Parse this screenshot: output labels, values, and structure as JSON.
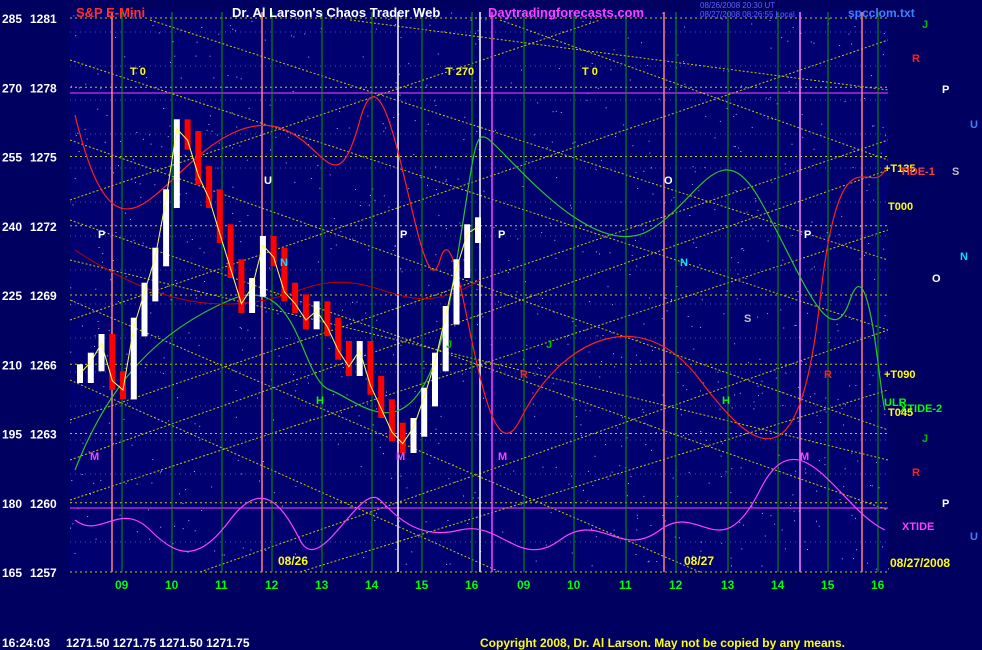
{
  "header": {
    "title_left": "S&P E-Mini",
    "title_center": "Dr. Al Larson's Chaos Trader Web",
    "site": "Daytradingforecasts.com",
    "file": "spcclom.txt",
    "small_info_1": "08/26/2008 20:30 UT",
    "small_info_2": "08/27/2008 08:26:55 Local"
  },
  "footer": {
    "time": "16:24:03",
    "quote": "1271.50  1271.75  1271.50  1271.75",
    "copyright": "Copyright 2008, Dr. Al Larson. May not be copied by any means."
  },
  "colors": {
    "background": "#000060",
    "price_up": "#ffffff",
    "price_down": "#ff0000",
    "grid_green": "#00c000",
    "grid_yellow": "#c8c800",
    "tide": "#ff40ff",
    "accent_text": "#ffff00"
  },
  "chart_data": {
    "type": "line",
    "y_axis_left_numbers": [
      "285",
      "270",
      "255",
      "240",
      "225",
      "210",
      "195",
      "180",
      "165"
    ],
    "y_axis_prices": [
      "1281",
      "1278",
      "1275",
      "1272",
      "1269",
      "1266",
      "1263",
      "1260",
      "1257"
    ],
    "ylim": [
      1257,
      1281
    ],
    "x_tick_labels": [
      "09",
      "10",
      "11",
      "12",
      "13",
      "14",
      "15",
      "16",
      "09",
      "10",
      "11",
      "12",
      "13",
      "14",
      "15",
      "16"
    ],
    "date_labels": [
      "08/26",
      "08/27",
      "08/27/2008"
    ],
    "series": [
      {
        "name": "S&P E-Mini",
        "values": [
          1265.5,
          1266.0,
          1266.8,
          1265.2,
          1264.8,
          1267.5,
          1269.0,
          1270.5,
          1273.0,
          1276.0,
          1275.5,
          1274.0,
          1273.0,
          1271.5,
          1270.0,
          1268.5,
          1269.2,
          1271.0,
          1270.5,
          1269.0,
          1268.5,
          1267.8,
          1268.2,
          1267.5,
          1266.5,
          1265.8,
          1266.5,
          1265.0,
          1264.0,
          1263.0,
          1262.5,
          1263.2,
          1264.5,
          1266.0,
          1268.0,
          1270.0,
          1271.5,
          1271.8
        ]
      }
    ],
    "right_labels": [
      {
        "text": "J",
        "color": "#00c000"
      },
      {
        "text": "R",
        "color": "#ff2020"
      },
      {
        "text": "P",
        "color": "#ffffff"
      },
      {
        "text": "U",
        "color": "#4080ff"
      },
      {
        "text": "+T135",
        "color": "#ffff00"
      },
      {
        "text": "TIDE-1",
        "color": "#ff4040"
      },
      {
        "text": "S",
        "color": "#c0c0c0"
      },
      {
        "text": "T000",
        "color": "#ffff00"
      },
      {
        "text": "N",
        "color": "#00e0ff"
      },
      {
        "text": "O",
        "color": "#ffffff"
      },
      {
        "text": "+T090",
        "color": "#ffff00"
      },
      {
        "text": "XTIDE-2",
        "color": "#00ff00"
      },
      {
        "text": "T045",
        "color": "#ffff00"
      },
      {
        "text": "J",
        "color": "#00c000"
      },
      {
        "text": "R",
        "color": "#ff2020"
      },
      {
        "text": "P",
        "color": "#ffffff"
      },
      {
        "text": "XTIDE",
        "color": "#ff40ff"
      },
      {
        "text": "U",
        "color": "#4080ff"
      }
    ],
    "chart_markers": [
      {
        "text": "T 0",
        "color": "#ffff00"
      },
      {
        "text": "T 270",
        "color": "#ffff00"
      },
      {
        "text": "T 0",
        "color": "#ffff00"
      },
      {
        "text": "P",
        "color": "#ffffff"
      },
      {
        "text": "U",
        "color": "#ffffff"
      },
      {
        "text": "P",
        "color": "#ffffff"
      },
      {
        "text": "P",
        "color": "#ffffff"
      },
      {
        "text": "O",
        "color": "#ffffff"
      },
      {
        "text": "P",
        "color": "#ffffff"
      },
      {
        "text": "N",
        "color": "#00e0ff"
      },
      {
        "text": "N",
        "color": "#00e0ff"
      },
      {
        "text": "S",
        "color": "#c0c0c0"
      },
      {
        "text": "H",
        "color": "#00ff00"
      },
      {
        "text": "H",
        "color": "#00ff00"
      },
      {
        "text": "J",
        "color": "#00c000"
      },
      {
        "text": "J",
        "color": "#00c000"
      },
      {
        "text": "R",
        "color": "#ff2020"
      },
      {
        "text": "R",
        "color": "#ff2020"
      },
      {
        "text": "M",
        "color": "#ff40ff"
      },
      {
        "text": "M",
        "color": "#ff40ff"
      },
      {
        "text": "M",
        "color": "#ff40ff"
      },
      {
        "text": "M",
        "color": "#ff40ff"
      },
      {
        "text": "ULR",
        "color": "#00ff00"
      }
    ],
    "grid": true
  }
}
